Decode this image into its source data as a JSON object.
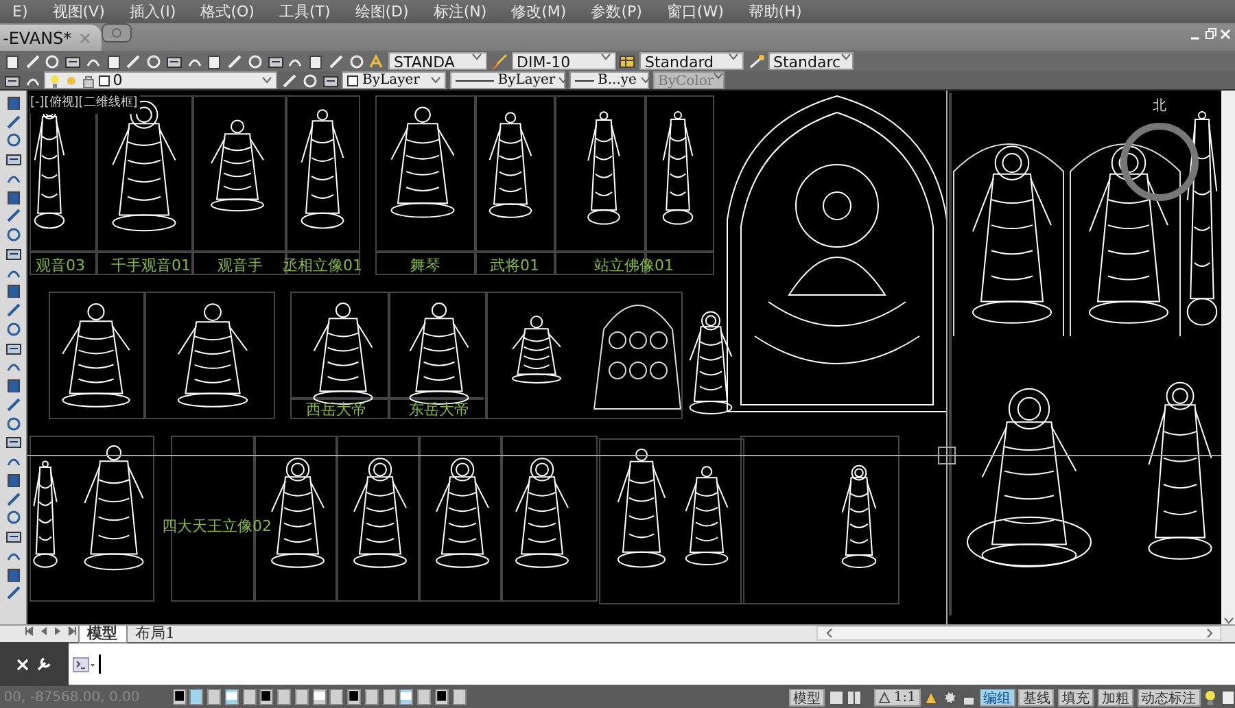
{
  "menu": [
    "E)",
    "视图(V)",
    "插入(I)",
    "格式(O)",
    "工具(T)",
    "绘图(D)",
    "标注(N)",
    "修改(M)",
    "参数(P)",
    "窗口(W)",
    "帮助(H)"
  ],
  "document_tab": {
    "title": "-EVANS*"
  },
  "styles_toolbar": {
    "text_style": "STANDA",
    "dim_style": "DIM-10",
    "table_style": "Standard",
    "multileader_style": "Standarc"
  },
  "layers_toolbar": {
    "layer": "0",
    "color_control": "ByLayer",
    "linetype": "ByLayer",
    "lineweight": "B...ye",
    "plot_style": "ByColor"
  },
  "viewport_label": "[-][俯视][二维线框]",
  "compass": "北",
  "drawing_labels": [
    {
      "text": "观音03"
    },
    {
      "text": "千手观音01"
    },
    {
      "text": "观音手"
    },
    {
      "text": "丞相立像01"
    },
    {
      "text": "舞琴"
    },
    {
      "text": "武将01"
    },
    {
      "text": "站立佛像01"
    },
    {
      "text": "西岳大帝"
    },
    {
      "text": "东岳大帝"
    },
    {
      "text": "四大天王立像02"
    }
  ],
  "layout_tabs": [
    {
      "label": "模型",
      "selected": true
    },
    {
      "label": "布局1",
      "selected": false
    }
  ],
  "status_bar": {
    "coordinates": "00, -87568.00, 0.00",
    "model_label": "模型",
    "annotation_scale": "1:1",
    "toggles": [
      {
        "label": "编组",
        "on": true
      },
      {
        "label": "基线",
        "on": false
      },
      {
        "label": "填充",
        "on": false
      },
      {
        "label": "加粗",
        "on": false
      },
      {
        "label": "动态标注",
        "on": false
      }
    ]
  }
}
